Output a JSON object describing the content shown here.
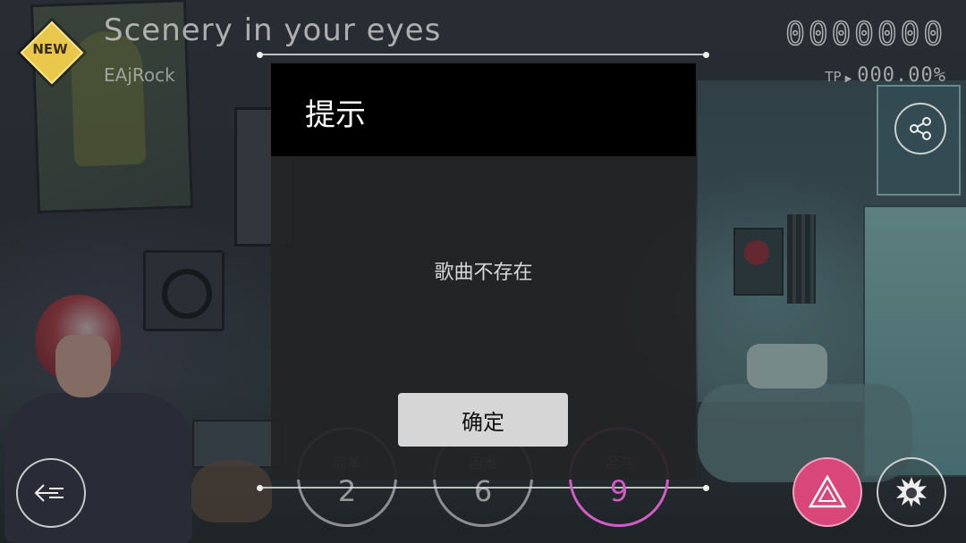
{
  "song": {
    "new_badge": "NEW",
    "title": "Scenery in your eyes",
    "artist": "EAjRock",
    "score": "0000000",
    "tp_label": "TP",
    "tp_value": "000.00%"
  },
  "difficulties": [
    {
      "name": "简单",
      "level": "2"
    },
    {
      "name": "困难",
      "level": "6"
    },
    {
      "name": "混沌",
      "level": "9",
      "selected": true
    }
  ],
  "icons": {
    "share": "share-icon",
    "back": "back-arrow-icon",
    "mode": "triangle-mode-icon",
    "character": "character-icon"
  },
  "colors": {
    "badge": "#e8c74a",
    "chaos": "#d25cc6",
    "mode_button": "#d9467a",
    "dialog_header": "#000000",
    "ok_button": "#d6d6d6"
  },
  "dialog": {
    "title": "提示",
    "message": "歌曲不存在",
    "ok_label": "确定"
  }
}
